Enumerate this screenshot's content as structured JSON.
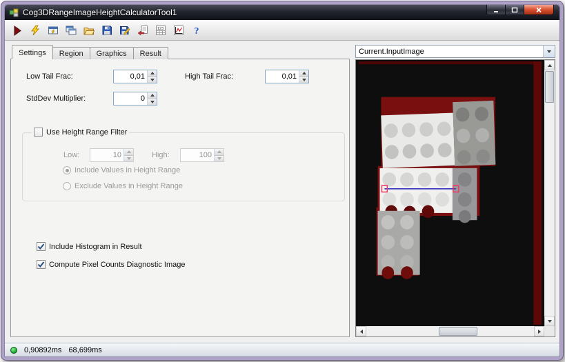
{
  "window": {
    "title": "Cog3DRangeImageHeightCalculatorTool1"
  },
  "toolbar": {
    "buttons": [
      "run",
      "run-electric",
      "show-current-image",
      "copy-tool-display",
      "open-file",
      "save",
      "save-as",
      "import-tool",
      "pixel-values-grid",
      "plot-results",
      "help"
    ]
  },
  "tabs": [
    {
      "label": "Settings",
      "active": true
    },
    {
      "label": "Region",
      "active": false
    },
    {
      "label": "Graphics",
      "active": false
    },
    {
      "label": "Result",
      "active": false
    }
  ],
  "settings": {
    "low_tail_frac_label": "Low Tail Frac:",
    "low_tail_frac_value": "0,01",
    "high_tail_frac_label": "High Tail Frac:",
    "high_tail_frac_value": "0,01",
    "stddev_label": "StdDev Multiplier:",
    "stddev_value": "0",
    "group": {
      "title_label": "Use Height Range Filter",
      "title_checked": false,
      "low_label": "Low:",
      "low_value": "10",
      "high_label": "High:",
      "high_value": "100",
      "include_label": "Include Values in Height Range",
      "include_selected": true,
      "exclude_label": "Exclude Values in Height Range",
      "exclude_selected": false
    },
    "histogram_label": "Include Histogram in Result",
    "histogram_checked": true,
    "pixel_counts_label": "Compute Pixel Counts Diagnostic Image",
    "pixel_counts_checked": true
  },
  "image_panel": {
    "selected_image": "Current.InputImage"
  },
  "status": {
    "process_time": "0,90892ms",
    "total_time": "68,699ms"
  },
  "colors": {
    "window_border": "#ada2c5",
    "range_red": "#7a0f0f",
    "status_green": "#23b23c",
    "region_line_blue": "#3333bb"
  }
}
